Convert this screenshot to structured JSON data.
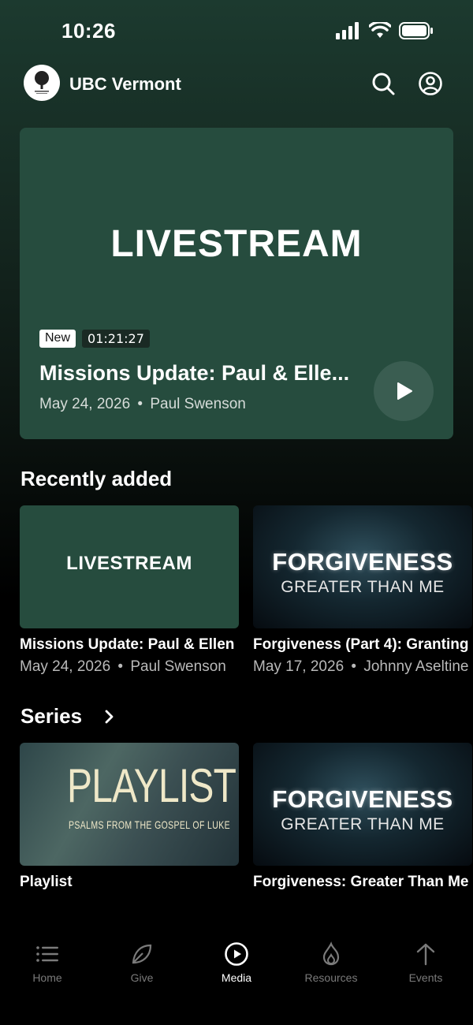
{
  "status_bar": {
    "time": "10:26"
  },
  "header": {
    "title": "UBC Vermont"
  },
  "hero": {
    "image_text": "LIVESTREAM",
    "badge_new": "New",
    "duration": "01:21:27",
    "title": "Missions Update: Paul & Elle...",
    "date": "May 24, 2026",
    "separator": "•",
    "speaker": "Paul Swenson"
  },
  "recently_added": {
    "heading": "Recently added",
    "items": [
      {
        "thumb_text": "LIVESTREAM",
        "title": "Missions Update: Paul & Ellen",
        "date": "May 24, 2026",
        "speaker": "Paul Swenson"
      },
      {
        "thumb_line1": "FORGIVENESS",
        "thumb_line2": "GREATER THAN ME",
        "title": "Forgiveness (Part 4): Granting",
        "date": "May 17, 2026",
        "speaker": "Johnny Aseltine"
      }
    ]
  },
  "series": {
    "heading": "Series",
    "items": [
      {
        "thumb_line1": "PLAYLIST",
        "thumb_line2": "PSALMS FROM THE GOSPEL OF LUKE",
        "title": "Playlist"
      },
      {
        "thumb_line1": "FORGIVENESS",
        "thumb_line2": "GREATER THAN ME",
        "title": "Forgiveness: Greater Than Me"
      }
    ]
  },
  "tabs": [
    {
      "label": "Home",
      "icon": "list-icon",
      "active": false
    },
    {
      "label": "Give",
      "icon": "leaf-icon",
      "active": false
    },
    {
      "label": "Media",
      "icon": "play-circle-icon",
      "active": true
    },
    {
      "label": "Resources",
      "icon": "flame-icon",
      "active": false
    },
    {
      "label": "Events",
      "icon": "arrow-up-icon",
      "active": false
    }
  ],
  "colors": {
    "accent_green": "#264c3e",
    "background": "#000000"
  }
}
